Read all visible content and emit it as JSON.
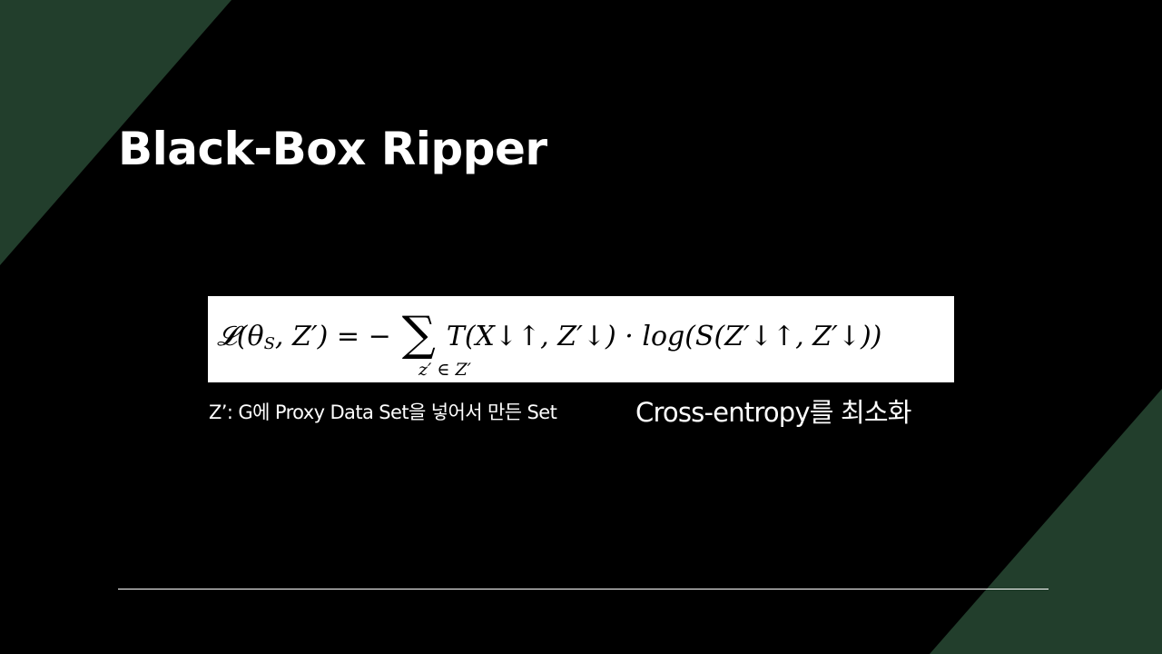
{
  "slide": {
    "title": "Black-Box Ripper",
    "formula": {
      "lhs": "𝓛(θ",
      "lhs_sub": "S",
      "lhs_rest": ", Z′) = −",
      "sum_symbol": "∑",
      "sum_subscript": "z′ ∈ Z′",
      "rhs": "T(X↓↑,  Z′↓) · log(S(Z′↓↑,  Z′↓))"
    },
    "caption_left": "Z’: G에 Proxy Data Set을 넣어서 만든 Set",
    "caption_right": "Cross-entropy를 최소화"
  },
  "colors": {
    "background": "#000000",
    "accent_green": "#223e2c",
    "text": "#ffffff",
    "formula_background": "#ffffff"
  }
}
